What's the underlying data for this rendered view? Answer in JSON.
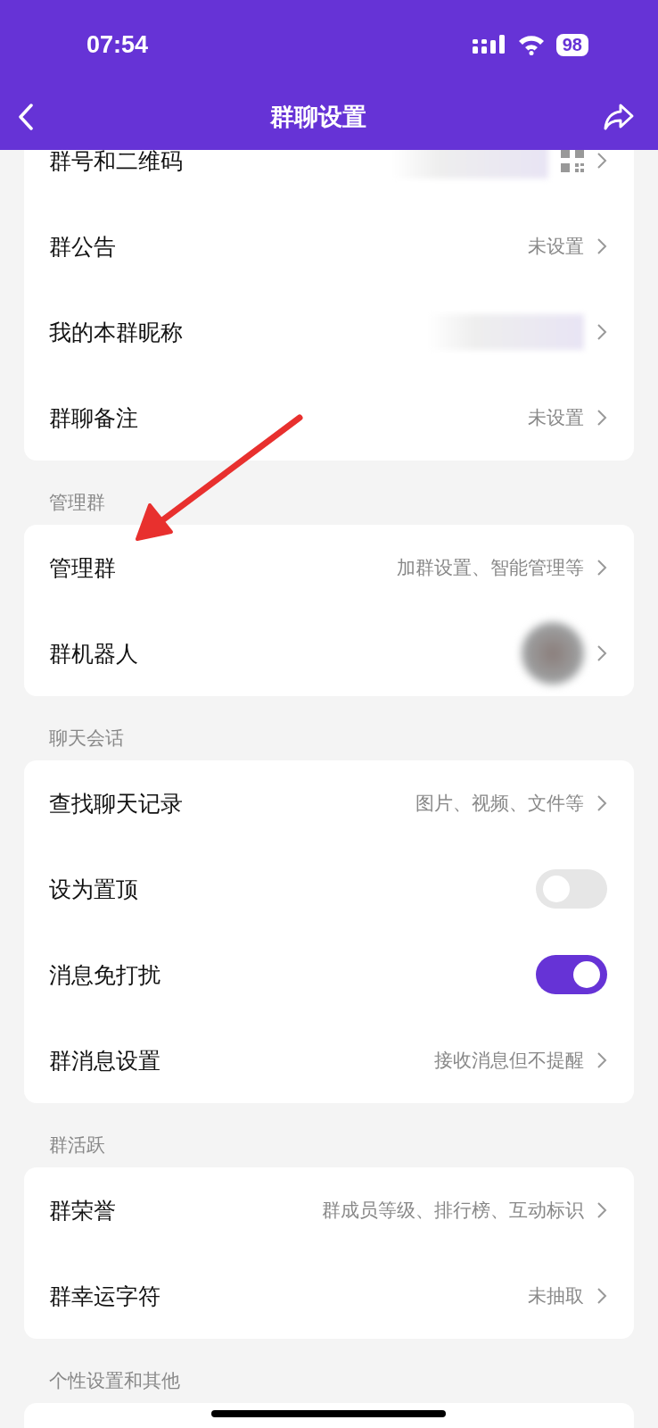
{
  "status_bar": {
    "time": "07:54",
    "battery": "98"
  },
  "nav": {
    "title": "群聊设置"
  },
  "sections": [
    {
      "rows": [
        {
          "kind": "link",
          "label": "群号和二维码",
          "redacted": true,
          "qr_icon": true
        },
        {
          "kind": "link",
          "label": "群公告",
          "value": "未设置"
        },
        {
          "kind": "link",
          "label": "我的本群昵称",
          "redacted": true
        },
        {
          "kind": "link",
          "label": "群聊备注",
          "value": "未设置"
        }
      ]
    },
    {
      "header": "管理群",
      "rows": [
        {
          "kind": "link",
          "label": "管理群",
          "value": "加群设置、智能管理等"
        },
        {
          "kind": "link",
          "label": "群机器人",
          "avatar": true
        }
      ]
    },
    {
      "header": "聊天会话",
      "rows": [
        {
          "kind": "link",
          "label": "查找聊天记录",
          "value": "图片、视频、文件等"
        },
        {
          "kind": "toggle",
          "label": "设为置顶",
          "on": false
        },
        {
          "kind": "toggle",
          "label": "消息免打扰",
          "on": true
        },
        {
          "kind": "link",
          "label": "群消息设置",
          "value": "接收消息但不提醒"
        }
      ]
    },
    {
      "header": "群活跃",
      "rows": [
        {
          "kind": "link",
          "label": "群荣誉",
          "value": "群成员等级、排行榜、互动标识"
        },
        {
          "kind": "link",
          "label": "群幸运字符",
          "value": "未抽取"
        }
      ]
    },
    {
      "header": "个性设置和其他"
    }
  ]
}
